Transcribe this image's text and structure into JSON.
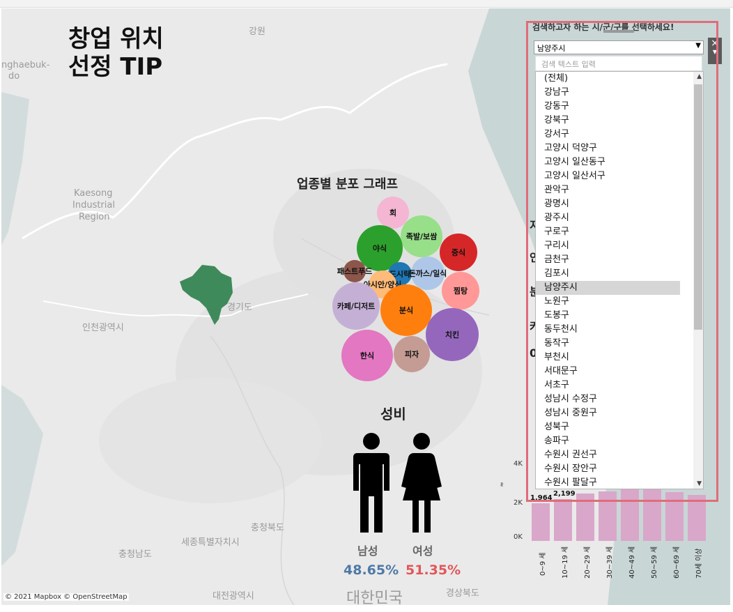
{
  "dashboard": {
    "title_line1": "창업 위치",
    "title_line2": "선정 TIP"
  },
  "map": {
    "labels": [
      "강원",
      "nghaebuk-",
      "do",
      "Kaesong",
      "Industrial",
      "Region",
      "경기도",
      "인천광역시",
      "충청북도",
      "세종특별자치시",
      "충청남도",
      "대전광역시",
      "경상북도"
    ],
    "country": "대한민국",
    "credit": "© 2021 Mapbox © OpenStreetMap",
    "land_color": "#eaeaea",
    "water_color": "#c9d6d6",
    "region_color": "#3f8a5a"
  },
  "bubble_chart": {
    "title": "업종별 분포 그래프",
    "bubbles": [
      {
        "label": "회",
        "color": "#f4b6d2"
      },
      {
        "label": "족발/보쌈",
        "color": "#98df8a"
      },
      {
        "label": "야식",
        "color": "#2ca02c"
      },
      {
        "label": "중식",
        "color": "#d62728"
      },
      {
        "label": "패스트푸드",
        "color": "#8c564b"
      },
      {
        "label": "도시락",
        "color": "#1f77b4"
      },
      {
        "label": "돈까스/일식",
        "color": "#aec7e8"
      },
      {
        "label": "아시안/양식",
        "color": "#ffbb78"
      },
      {
        "label": "찜탕",
        "color": "#ff9896"
      },
      {
        "label": "카페/디저트",
        "color": "#c5b0d5"
      },
      {
        "label": "분식",
        "color": "#ff7f0e"
      },
      {
        "label": "치킨",
        "color": "#9467bd"
      },
      {
        "label": "한식",
        "color": "#e377c2"
      },
      {
        "label": "피자",
        "color": "#c49c94"
      }
    ]
  },
  "gender": {
    "title": "성비",
    "male_label": "남성",
    "female_label": "여성",
    "male_pct": "48.65%",
    "female_pct": "51.35%",
    "male_color": "#4e79a7",
    "female_color": "#e15759"
  },
  "age_chart": {
    "y_ticks": [
      "4K",
      "2K",
      "0K"
    ],
    "value_labels": [
      "1,964",
      "2,199"
    ],
    "categories": [
      "0~9 세",
      "10~19 세",
      "20~29 세",
      "30~39 세",
      "40~49 세",
      "50~59 세",
      "60~69 세",
      "70세 이상"
    ],
    "bar_color": "#d9a7c9"
  },
  "filter": {
    "header": "검색하고자 하는 시/군/구를 선택하세요!",
    "selected": "남양주시",
    "search_placeholder": "검색 텍스트 입력",
    "close": "×",
    "items": [
      "(전체)",
      "강남구",
      "강동구",
      "강북구",
      "강서구",
      "고양시 덕양구",
      "고양시 일산동구",
      "고양시 일산서구",
      "관악구",
      "광명시",
      "광주시",
      "구로구",
      "구리시",
      "금천구",
      "김포시",
      "남양주시",
      "노원구",
      "도봉구",
      "동두천시",
      "동작구",
      "부천시",
      "서대문구",
      "서초구",
      "성남시 수정구",
      "성남시 중원구",
      "성북구",
      "송파구",
      "수원시 권선구",
      "수원시 장안구",
      "수원시 팔달구"
    ],
    "highlight_color": "#e06c7a"
  }
}
